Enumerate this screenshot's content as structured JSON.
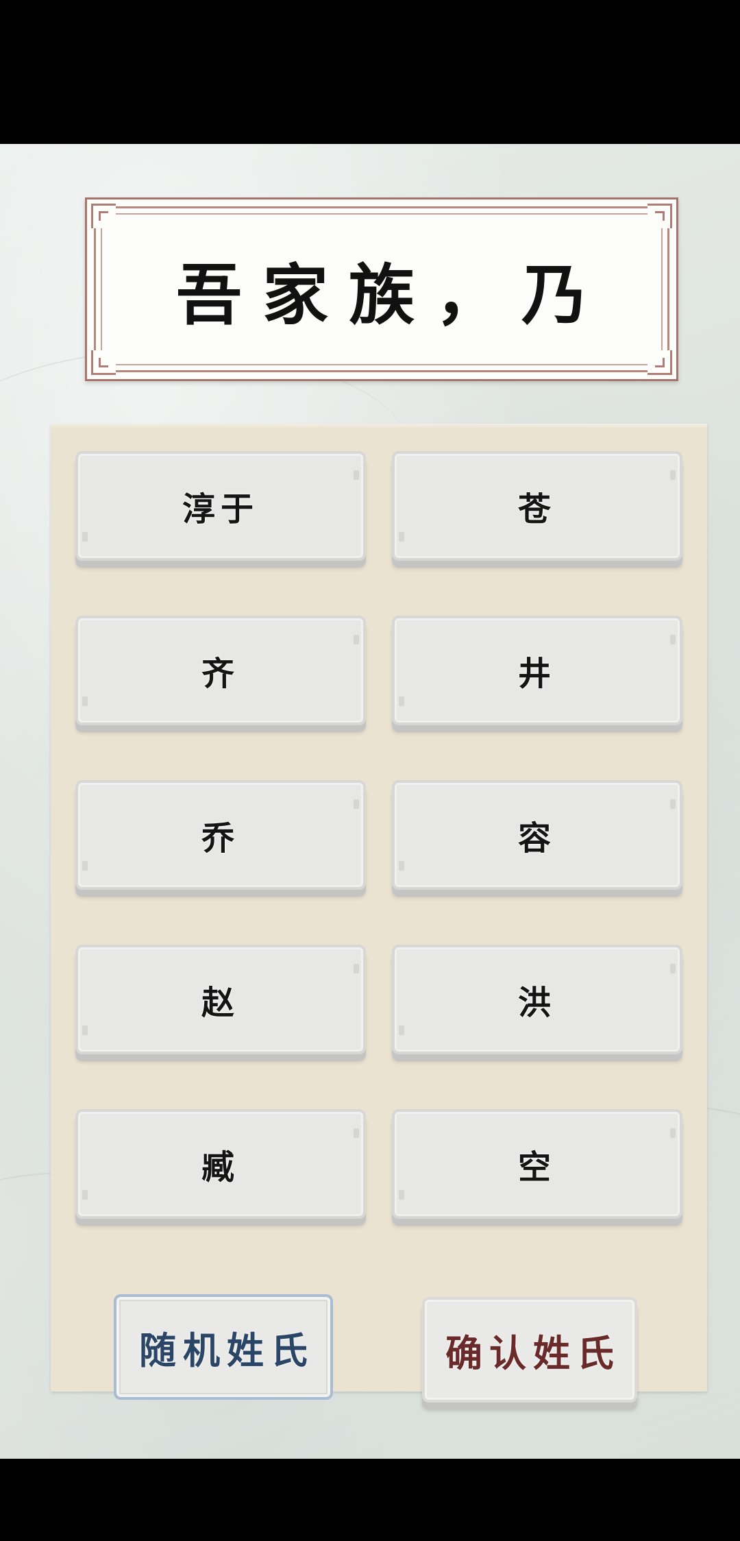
{
  "title": "吾家族，乃",
  "surname_options": [
    {
      "label": "淳于"
    },
    {
      "label": "苍"
    },
    {
      "label": "齐"
    },
    {
      "label": "井"
    },
    {
      "label": "乔"
    },
    {
      "label": "容"
    },
    {
      "label": "赵"
    },
    {
      "label": "洪"
    },
    {
      "label": "臧"
    },
    {
      "label": "空"
    }
  ],
  "actions": {
    "random_label": "随机姓氏",
    "confirm_label": "确认姓氏"
  },
  "colors": {
    "plaque_border": "#a8736b",
    "panel_bg": "#ebe3d2",
    "random_text": "#2b4566",
    "confirm_text": "#6a2a2a"
  }
}
